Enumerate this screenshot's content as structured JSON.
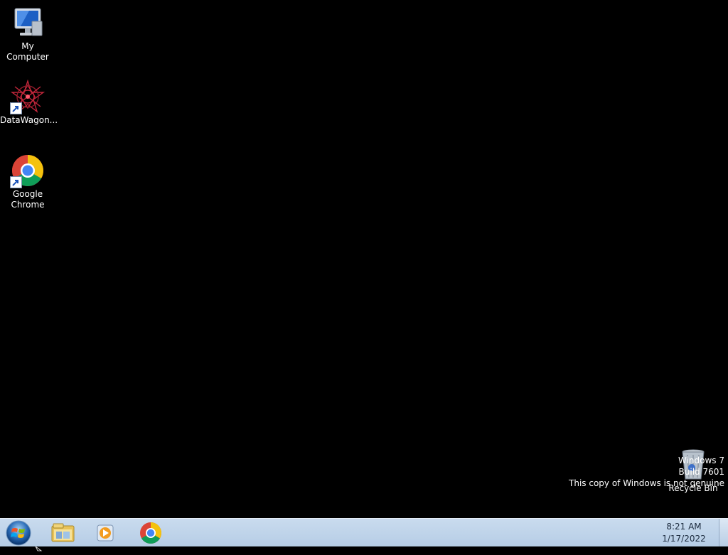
{
  "desktop": {
    "icons": [
      {
        "label": "My Computer",
        "icon": "computer-icon"
      },
      {
        "label": "DataWagon...",
        "icon": "datawagon-icon"
      },
      {
        "label": "Google Chrome",
        "icon": "chrome-icon"
      }
    ],
    "recycle_bin": {
      "label": "Recycle Bin",
      "icon": "recycle-bin-icon"
    },
    "watermark": {
      "line1": "Windows 7",
      "line2": "Build 7601",
      "line3": "This copy of Windows is not genuine"
    }
  },
  "taskbar": {
    "start": {
      "icon": "windows-start-orb-icon"
    },
    "pinned": [
      {
        "icon": "file-explorer-icon"
      },
      {
        "icon": "media-player-icon"
      },
      {
        "icon": "chrome-icon"
      }
    ],
    "clock": {
      "time": "8:21 AM",
      "date": "1/17/2022"
    }
  },
  "colors": {
    "desktop_bg": "#000000",
    "taskbar_bg": "#c0d5ea",
    "chrome_red": "#db4437",
    "chrome_yellow": "#f4c20d",
    "chrome_green": "#0f9d58",
    "chrome_blue": "#4285f4"
  }
}
